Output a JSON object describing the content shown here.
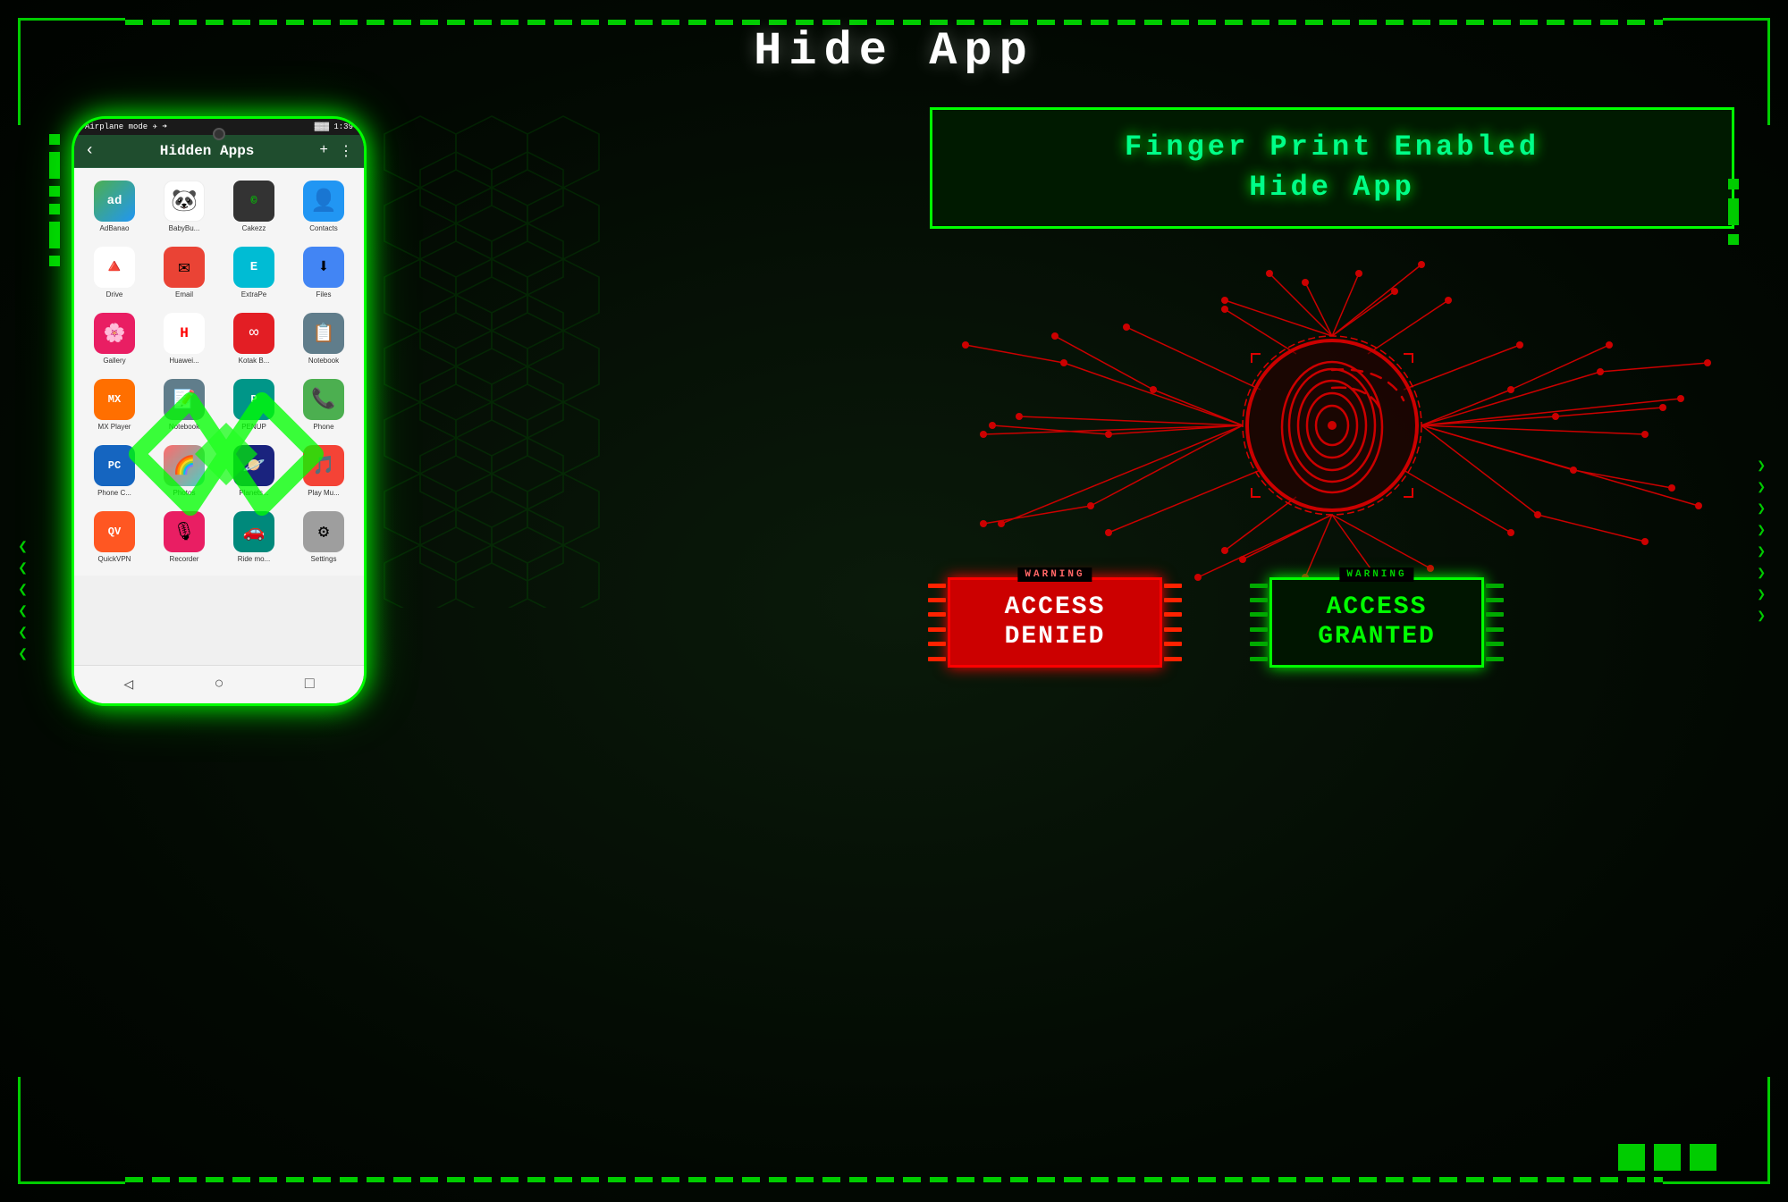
{
  "page": {
    "title": "Hide App",
    "background_color": "#000a00"
  },
  "header": {
    "title": "Hide App"
  },
  "fingerprint_label": {
    "line1": "Finger Print Enabled",
    "line2": "Hide App"
  },
  "badges": {
    "denied": {
      "warning": "WARNING",
      "text": "ACCESS\nDENIED"
    },
    "granted": {
      "warning": "WARNING",
      "text": "ACCESS\nGRANTED"
    }
  },
  "phone": {
    "status": {
      "left": "Airplane mode ✈ ➜",
      "right": "▓▓▓ 1:39"
    },
    "header_title": "Hidden Apps",
    "apps": [
      {
        "label": "AdBanao",
        "icon": "ad"
      },
      {
        "label": "BabyBu...",
        "icon": "panda"
      },
      {
        "label": "Cakezz",
        "icon": "green"
      },
      {
        "label": "Contacts",
        "icon": "blue"
      },
      {
        "label": "Drive",
        "icon": "drive"
      },
      {
        "label": "Email",
        "icon": "email"
      },
      {
        "label": "ExtraPe",
        "icon": "extra"
      },
      {
        "label": "Files",
        "icon": "files"
      },
      {
        "label": "Gallery",
        "icon": "gallery"
      },
      {
        "label": "Huawei...",
        "icon": "huawei"
      },
      {
        "label": "Kotak B...",
        "icon": "kotak"
      },
      {
        "label": "Notebook",
        "icon": "notebook"
      },
      {
        "label": "MX Player",
        "icon": "mx"
      },
      {
        "label": "Notebook",
        "icon": "notebook2"
      },
      {
        "label": "PENUP",
        "icon": "penup"
      },
      {
        "label": "Phone",
        "icon": "phone"
      },
      {
        "label": "Phone C...",
        "icon": "phonec"
      },
      {
        "label": "Photos",
        "icon": "photos"
      },
      {
        "label": "Planets...",
        "icon": "planets"
      },
      {
        "label": "Play Mu...",
        "icon": "play"
      },
      {
        "label": "QuickVPN",
        "icon": "qv"
      },
      {
        "label": "Recorder",
        "icon": "recorder"
      },
      {
        "label": "Ride mo...",
        "icon": "ride"
      },
      {
        "label": "Settings",
        "icon": "settings"
      }
    ],
    "nav": {
      "back": "◁",
      "home": "○",
      "recent": "□"
    }
  },
  "icons": {
    "chevron_down": "❯",
    "warning": "⚠"
  }
}
